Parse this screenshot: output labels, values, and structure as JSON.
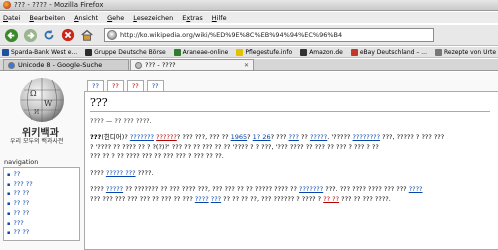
{
  "window": {
    "title": "??? - ???? - Mozilla Firefox"
  },
  "menu": {
    "items": [
      {
        "pre": "",
        "ul": "D",
        "post": "atei"
      },
      {
        "pre": "",
        "ul": "B",
        "post": "earbeiten"
      },
      {
        "pre": "",
        "ul": "A",
        "post": "nsicht"
      },
      {
        "pre": "",
        "ul": "G",
        "post": "ehe"
      },
      {
        "pre": "",
        "ul": "L",
        "post": "esezeichen"
      },
      {
        "pre": "E",
        "ul": "x",
        "post": "tras"
      },
      {
        "pre": "",
        "ul": "H",
        "post": "ilfe"
      }
    ]
  },
  "navbar": {
    "url": "http://ko.wikipedia.org/wiki/%ED%9E%8C%EB%94%94%EC%96%B4"
  },
  "bookmarks": [
    {
      "label": "Sparda-Bank West e...",
      "color": "#1f4fa0"
    },
    {
      "label": "Gruppe Deutsche Börse",
      "color": "#2b2b2b"
    },
    {
      "label": "Araneae-online",
      "color": "#2f7d2f"
    },
    {
      "label": "Pflegestufe.info",
      "color": "#e0c200"
    },
    {
      "label": "Amazon.de",
      "color": "#333333"
    },
    {
      "label": "eBay Deutschland – ...",
      "color": "#c0392b"
    },
    {
      "label": "Rezepte von Urte",
      "color": "#777777"
    }
  ],
  "tabs": [
    {
      "label": "Unicode 8 - Google-Suche",
      "active": false
    },
    {
      "label": "??? - ????",
      "active": true
    }
  ],
  "sidebar": {
    "logo_line1": "위키백과",
    "logo_line2": "우리 모두의 백과사전",
    "nav_heading": "navigation",
    "nav_items": [
      "??",
      "??? ??",
      "?? ??",
      "?? ??",
      "?? ??",
      "???",
      "?? ??"
    ]
  },
  "content_tabs": [
    {
      "label": "??",
      "style": "main"
    },
    {
      "label": "??",
      "style": "red"
    },
    {
      "label": "??",
      "style": "red"
    },
    {
      "label": "??",
      "style": "main"
    }
  ],
  "article": {
    "title": "???",
    "subtitle": "???? — ?? ??? ????.",
    "p1": [
      {
        "t": "???",
        "c": "b"
      },
      {
        "t": "(힌디어)",
        "c": ""
      },
      {
        "t": "? ",
        "c": ""
      },
      {
        "t": "???????",
        "c": "lk"
      },
      {
        "t": " ",
        "c": ""
      },
      {
        "t": "??????",
        "c": "rd"
      },
      {
        "t": "? ??? ???, ??? ?? ",
        "c": ""
      },
      {
        "t": "1965",
        "c": "lk"
      },
      {
        "t": "? ",
        "c": ""
      },
      {
        "t": "1? 26",
        "c": "lk"
      },
      {
        "t": "? ??? ",
        "c": ""
      },
      {
        "t": "???",
        "c": "lk"
      },
      {
        "t": " ?? ",
        "c": ""
      },
      {
        "t": "?????",
        "c": "lk"
      },
      {
        "t": ". '????? ",
        "c": ""
      },
      {
        "t": "????????",
        "c": "lk"
      },
      {
        "t": " ???, ????? ? ??? ???",
        "c": ""
      }
    ],
    "p2": "? '???? ?? ???? ?? ? ?(?)?' ??? ?? ?? ??? ?? ?? '???? ? ? ???, '??? ???? ?? ??? ?? ??? ? ??? ? ??",
    "p3": "??? ?? ? ?? ???? ??? ?? ??? ??? ? ??? ?? ??.",
    "p4": [
      {
        "t": "???? ",
        "c": ""
      },
      {
        "t": "????? ???",
        "c": "lk"
      },
      {
        "t": " ????.",
        "c": ""
      }
    ],
    "p5": [
      {
        "t": "???? ",
        "c": ""
      },
      {
        "t": "?????",
        "c": "lk"
      },
      {
        "t": " ?? ??????? ?? ??? ???? ???, ??? ??? ?? ?? ????? ???? ?? ",
        "c": ""
      },
      {
        "t": "???????",
        "c": "lk"
      },
      {
        "t": " ???. ??? ???? ???? ??? ??? ",
        "c": ""
      },
      {
        "t": "????",
        "c": "lk"
      }
    ],
    "p6": [
      {
        "t": "??? ??? ??? ??? ??? ?? ??? ?? ??? ",
        "c": ""
      },
      {
        "t": "????",
        "c": "lk"
      },
      {
        "t": " ",
        "c": ""
      },
      {
        "t": "???",
        "c": "lk"
      },
      {
        "t": " ?? ?? ?? ??, ??? ?????? ? ???? ? ",
        "c": ""
      },
      {
        "t": "?? ??",
        "c": "rd"
      },
      {
        "t": " ??? ?? ??? ????.",
        "c": ""
      }
    ]
  }
}
